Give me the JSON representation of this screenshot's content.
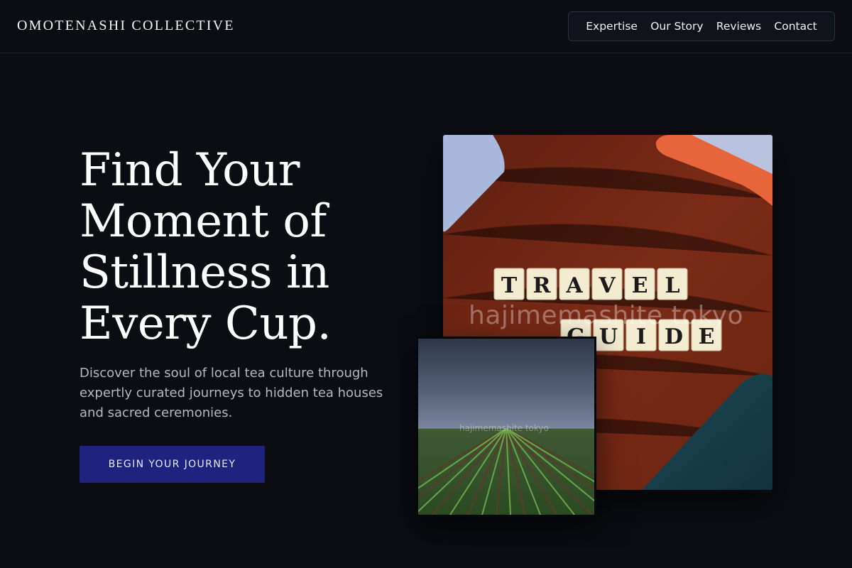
{
  "header": {
    "brand": "OMOTENASHI COLLECTIVE",
    "nav": [
      "Expertise",
      "Our Story",
      "Reviews",
      "Contact"
    ]
  },
  "hero": {
    "title": "Find Your Moment of Stillness in Every Cup.",
    "subtitle": "Discover the soul of local tea culture through expertly curated journeys to hidden tea houses and sacred ceremonies.",
    "cta": "BEGIN YOUR JOURNEY"
  },
  "images": {
    "main_tiles_row1": [
      "T",
      "R",
      "A",
      "V",
      "E",
      "L"
    ],
    "main_tiles_row2": [
      "G",
      "U",
      "I",
      "D",
      "E"
    ],
    "watermark": "hajimemashite tokyo"
  },
  "colors": {
    "background": "#0b0d13",
    "cta": "#1f2380",
    "wood": "#7a2a17"
  }
}
